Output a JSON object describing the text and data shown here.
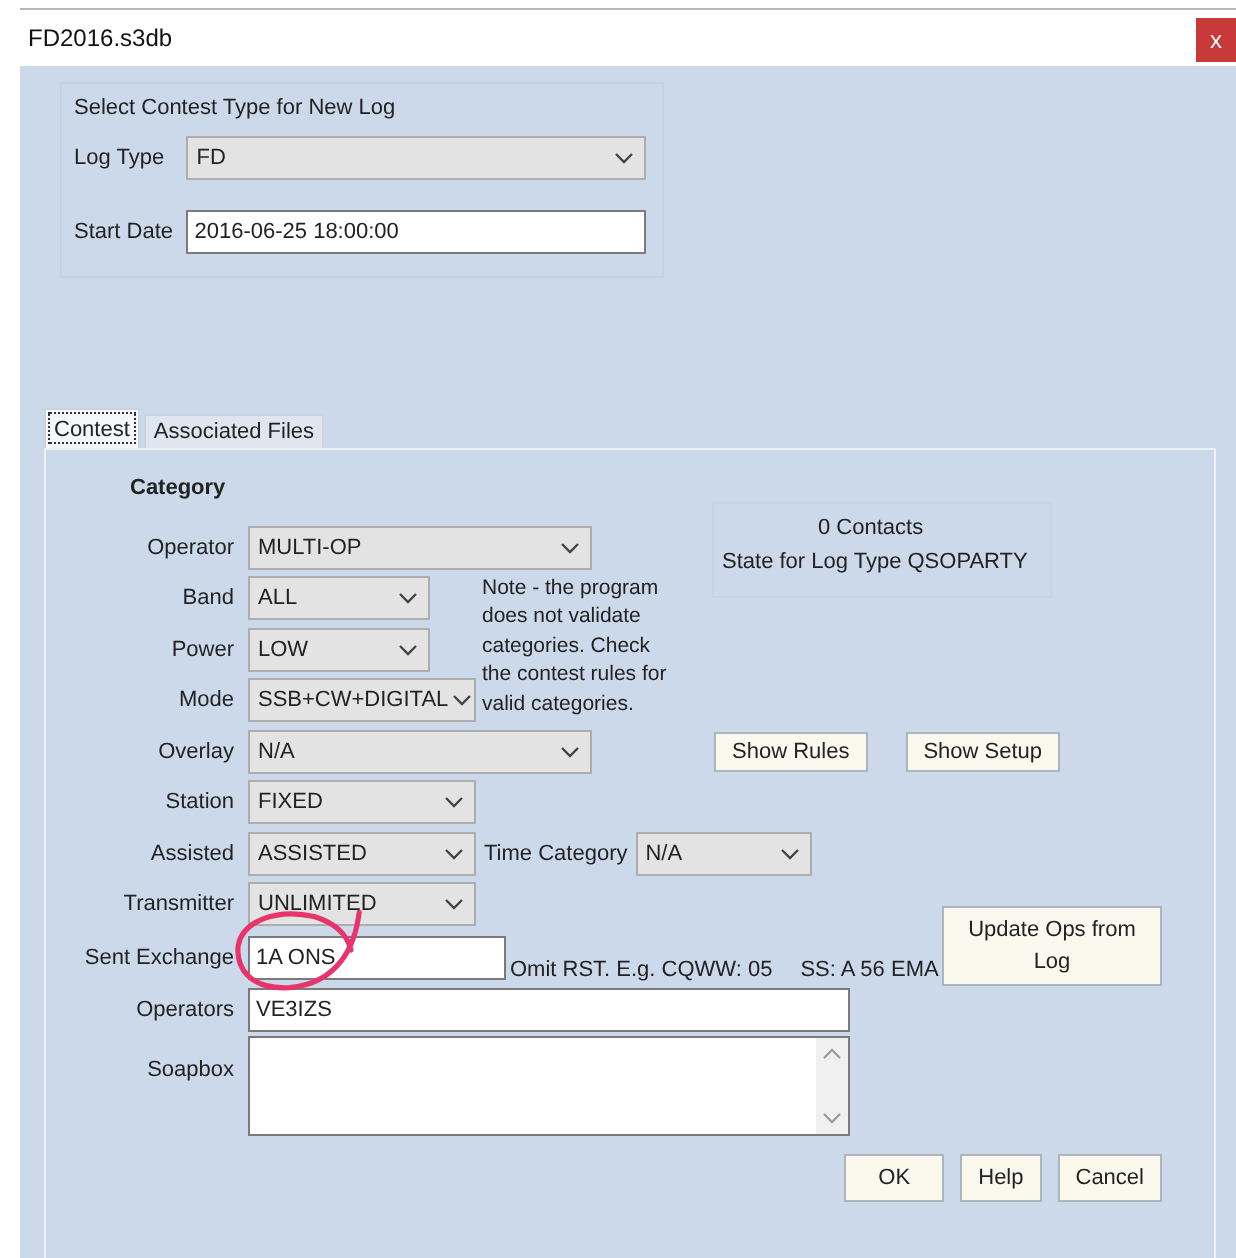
{
  "window": {
    "title": "FD2016.s3db",
    "close_label": "x"
  },
  "new_log": {
    "heading": "Select Contest Type for New Log",
    "fields": [
      {
        "label": "Log Type",
        "kind": "select",
        "value": "FD"
      },
      {
        "label": "Start Date",
        "kind": "text",
        "value": "2016-06-25 18:00:00"
      }
    ]
  },
  "tabs": [
    {
      "label": "Contest",
      "selected": true
    },
    {
      "label": "Associated Files",
      "selected": false
    }
  ],
  "category": {
    "heading": "Category",
    "rows": [
      {
        "label": "Operator",
        "kind": "wide",
        "value": "MULTI-OP"
      },
      {
        "label": "Band",
        "kind": "narrow",
        "value": "ALL"
      },
      {
        "label": "Power",
        "kind": "narrow",
        "value": "LOW"
      },
      {
        "label": "Mode",
        "kind": "medium",
        "value": "SSB+CW+DIGITAL"
      },
      {
        "label": "Overlay",
        "kind": "wide",
        "value": "N/A"
      },
      {
        "label": "Station",
        "kind": "medium",
        "value": "FIXED"
      },
      {
        "label": "Assisted",
        "kind": "medium",
        "value": "ASSISTED"
      },
      {
        "label": "Transmitter",
        "kind": "medium",
        "value": "UNLIMITED"
      }
    ],
    "time_category": {
      "label": "Time Category",
      "value": "N/A"
    },
    "note": "Note -  the program does not validate categories. Check the contest rules for valid categories.",
    "info": [
      "0 Contacts",
      "State for Log Type QSOPARTY"
    ],
    "buttons": [
      "Show Rules",
      "Show Setup"
    ]
  },
  "exchange": {
    "label": "Sent Exchange",
    "value": "1A ONS",
    "hints": [
      "Omit RST. E.g. CQWW: 05",
      "SS: A 56 EMA"
    ]
  },
  "update_button": "Update Ops from Log",
  "operators": {
    "label": "Operators",
    "value": "VE3IZS"
  },
  "soapbox": {
    "label": "Soapbox"
  },
  "actions": [
    "OK",
    "Help",
    "Cancel"
  ]
}
